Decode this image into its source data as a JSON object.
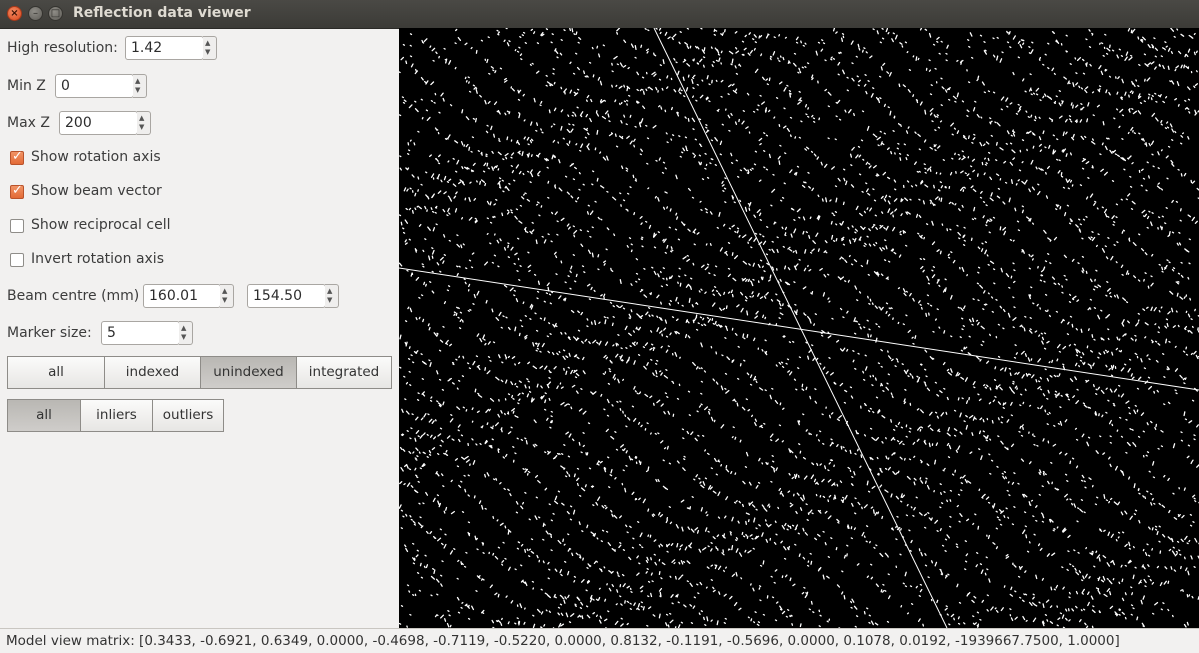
{
  "window": {
    "title": "Reflection data viewer"
  },
  "controls": {
    "high_resolution": {
      "label": "High resolution:",
      "value": "1.42"
    },
    "min_z": {
      "label": "Min Z",
      "value": "0"
    },
    "max_z": {
      "label": "Max Z",
      "value": "200"
    },
    "show_rotation_axis": {
      "label": "Show rotation axis",
      "checked": true
    },
    "show_beam_vector": {
      "label": "Show beam vector",
      "checked": true
    },
    "show_reciprocal_cell": {
      "label": "Show reciprocal cell",
      "checked": false
    },
    "invert_rotation_axis": {
      "label": "Invert rotation axis",
      "checked": false
    },
    "beam_centre": {
      "label": "Beam centre (mm)",
      "x": "160.01",
      "y": "154.50"
    },
    "marker_size": {
      "label": "Marker size:",
      "value": "5"
    },
    "reflection_filter": {
      "options": [
        "all",
        "indexed",
        "unindexed",
        "integrated"
      ],
      "selected": "unindexed"
    },
    "outlier_filter": {
      "options": [
        "all",
        "inliers",
        "outliers"
      ],
      "selected": "all"
    }
  },
  "status": {
    "model_view_matrix": "Model view matrix: [0.3433, -0.6921, 0.6349, 0.0000, -0.4698, -0.7119, -0.5220, 0.0000, 0.8132, -0.1191, -0.5696, 0.0000, 0.1078, 0.0192, -1939667.7500, 1.0000]"
  },
  "colors": {
    "checkbox_accent": "#e8703a",
    "viewer_background": "#000000",
    "point_color": "#ffffff",
    "titlebar": "#3c3b37"
  }
}
